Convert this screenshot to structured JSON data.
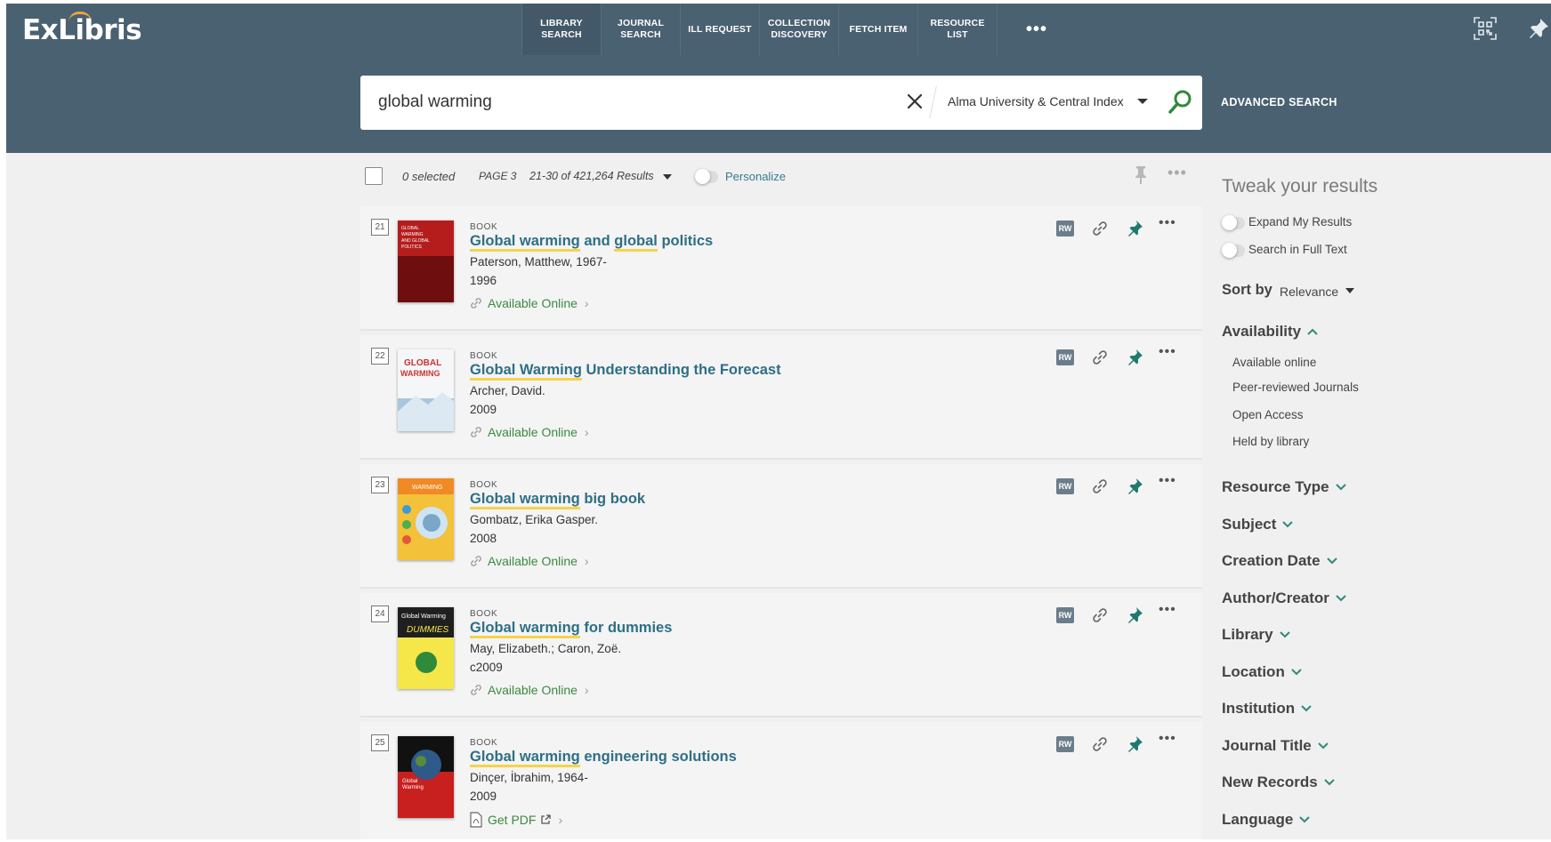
{
  "app": {
    "logo_text": "ExLibris"
  },
  "nav": {
    "items": [
      {
        "label": "LIBRARY\nSEARCH"
      },
      {
        "label": "JOURNAL\nSEARCH"
      },
      {
        "label": "ILL REQUEST"
      },
      {
        "label": "COLLECTION\nDISCOVERY"
      },
      {
        "label": "FETCH ITEM"
      },
      {
        "label": "RESOURCE\nLIST"
      }
    ],
    "more_label": "•••"
  },
  "search": {
    "query": "global warming",
    "scope": "Alma University & Central Index",
    "advanced_label": "ADVANCED SEARCH"
  },
  "toolbar": {
    "selected": "0 selected",
    "page": "PAGE 3",
    "results_count": "21-30 of 421,264 Results",
    "personalize": "Personalize",
    "more": "•••"
  },
  "results": [
    {
      "num": "21",
      "type": "BOOK",
      "title_pre": "",
      "title_hl": "Global warming",
      "title_mid": " and ",
      "title_hl2": "global",
      "title_post": " politics",
      "author": "Paterson, Matthew, 1967-",
      "date": "1996",
      "access": "Available Online"
    },
    {
      "num": "22",
      "type": "BOOK",
      "title_pre": "",
      "title_hl": "Global Warming",
      "title_mid": " Understanding the Forecast",
      "title_hl2": "",
      "title_post": "",
      "author": "Archer, David.",
      "date": "2009",
      "access": "Available Online"
    },
    {
      "num": "23",
      "type": "BOOK",
      "title_pre": "",
      "title_hl": "Global warming",
      "title_mid": " big book",
      "title_hl2": "",
      "title_post": "",
      "author": "Gombatz, Erika Gasper.",
      "date": "2008",
      "access": "Available Online"
    },
    {
      "num": "24",
      "type": "BOOK",
      "title_pre": "",
      "title_hl": "Global warming",
      "title_mid": " for dummies",
      "title_hl2": "",
      "title_post": "",
      "author": "May, Elizabeth.; Caron, Zoë.",
      "date": "c2009",
      "access": "Available Online"
    },
    {
      "num": "25",
      "type": "BOOK",
      "title_pre": "",
      "title_hl": "Global warming",
      "title_mid": " engineering solutions",
      "title_hl2": "",
      "title_post": "",
      "author": "Dinçer, İbrahim, 1964-",
      "date": "2009",
      "access": "Get PDF"
    }
  ],
  "result_actions": {
    "rw_label": "RW",
    "more": "•••"
  },
  "sidebar": {
    "title": "Tweak your results",
    "expand_label": "Expand My Results",
    "fulltext_label": "Search in Full Text",
    "sort_label": "Sort by",
    "sort_value": "Relevance",
    "availability": {
      "label": "Availability",
      "options": [
        "Available online",
        "Peer-reviewed Journals",
        "Open Access",
        "Held by library"
      ]
    },
    "facets": [
      "Resource Type",
      "Subject",
      "Creation Date",
      "Author/Creator",
      "Library",
      "Location",
      "Institution",
      "Journal Title",
      "New Records",
      "Language"
    ]
  },
  "colors": {
    "header_bg": "#4a6172",
    "link_title": "#2e6f86",
    "available_green": "#3b8a3e",
    "highlight_yellow": "#f5d34c",
    "accent_teal": "#3a7a8c"
  },
  "icons": {
    "clear": "close-icon",
    "search": "magnifier-icon",
    "qr": "qr-code-icon",
    "pin": "pin-icon",
    "link": "link-icon",
    "pdf": "pdf-icon",
    "external": "external-link-icon"
  }
}
